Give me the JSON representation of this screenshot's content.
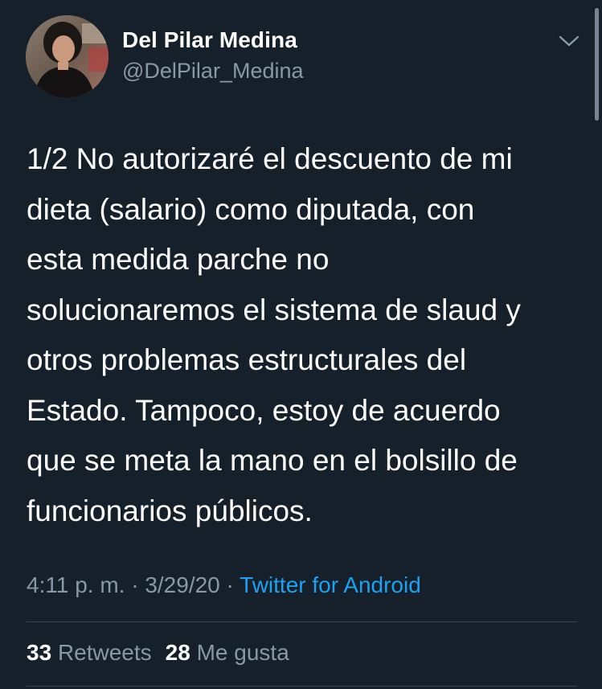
{
  "author": {
    "display_name": "Del Pilar Medina",
    "handle": "@DelPilar_Medina"
  },
  "tweet": {
    "text": "1/2 No autorizaré el descuento de mi\ndieta (salario) como diputada, con\nesta medida parche no\nsolucionaremos el sistema de slaud y\notros problemas estructurales del\nEstado. Tampoco, estoy de acuerdo\nque se meta la mano en el bolsillo de\nfuncionarios públicos."
  },
  "meta": {
    "time": "4:11 p. m.",
    "separator": " · ",
    "date": "3/29/20",
    "source": "Twitter for Android"
  },
  "stats": {
    "retweets_count": "33",
    "retweets_label": "Retweets",
    "likes_count": "28",
    "likes_label": "Me gusta"
  },
  "icons": {
    "menu": "chevron-down-icon"
  },
  "colors": {
    "background": "#15202b",
    "text": "#ffffff",
    "secondary_text": "#8899a6",
    "link": "#1da1f2",
    "divider": "#38444d"
  }
}
